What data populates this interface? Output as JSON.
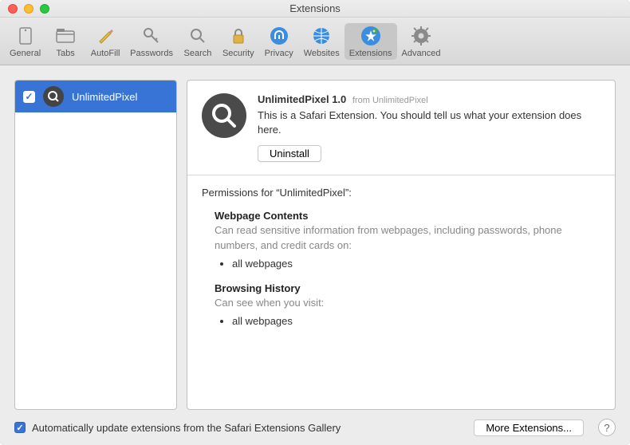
{
  "window": {
    "title": "Extensions"
  },
  "toolbar": {
    "items": [
      {
        "label": "General"
      },
      {
        "label": "Tabs"
      },
      {
        "label": "AutoFill"
      },
      {
        "label": "Passwords"
      },
      {
        "label": "Search"
      },
      {
        "label": "Security"
      },
      {
        "label": "Privacy"
      },
      {
        "label": "Websites"
      },
      {
        "label": "Extensions"
      },
      {
        "label": "Advanced"
      }
    ]
  },
  "sidebar": {
    "items": [
      {
        "name": "UnlimitedPixel",
        "checked": true
      }
    ]
  },
  "detail": {
    "title": "UnlimitedPixel 1.0",
    "from": "from UnlimitedPixel",
    "description": "This is a Safari Extension. You should tell us what your extension does here.",
    "uninstall_label": "Uninstall",
    "permissions_heading": "Permissions for “UnlimitedPixel”:",
    "permissions": [
      {
        "title": "Webpage Contents",
        "desc": "Can read sensitive information from webpages, including passwords, phone numbers, and credit cards on:",
        "list": [
          "all webpages"
        ]
      },
      {
        "title": "Browsing History",
        "desc": "Can see when you visit:",
        "list": [
          "all webpages"
        ]
      }
    ]
  },
  "footer": {
    "auto_update_checked": true,
    "auto_update_label": "Automatically update extensions from the Safari Extensions Gallery",
    "more_label": "More Extensions...",
    "help_label": "?"
  }
}
